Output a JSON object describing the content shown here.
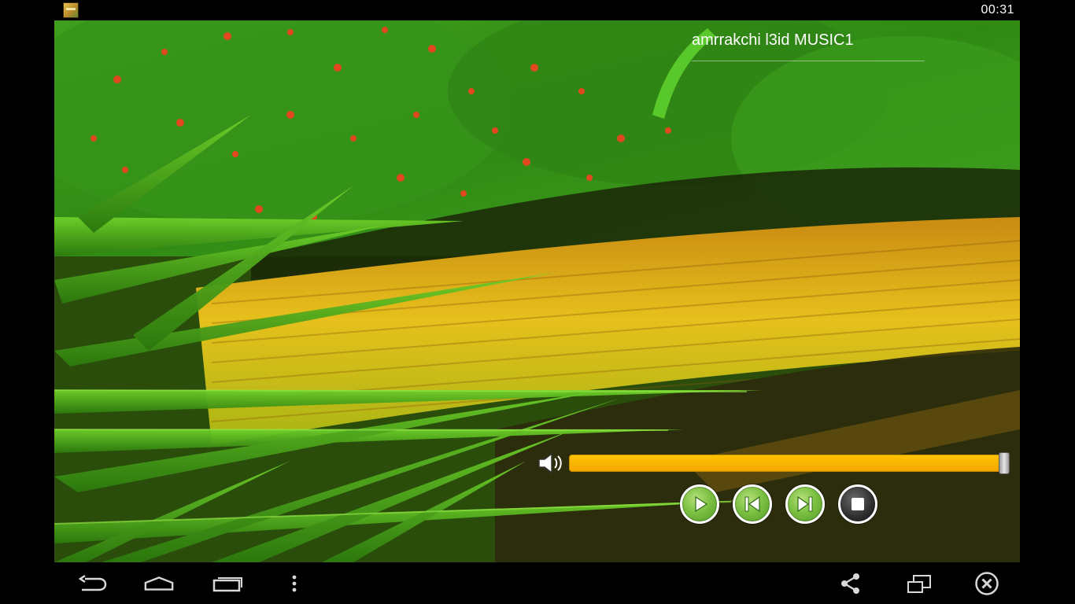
{
  "status_bar": {
    "time": "00:31",
    "notification_icon": "app-icon"
  },
  "player": {
    "track_title": "amrrakchi l3id MUSIC1",
    "volume_level_percent": 100,
    "volume_icon": "speaker-icon",
    "controls": [
      {
        "name": "play-button",
        "icon": "play-icon"
      },
      {
        "name": "previous-button",
        "icon": "skip-previous-icon"
      },
      {
        "name": "next-button",
        "icon": "skip-next-icon"
      },
      {
        "name": "stop-button",
        "icon": "stop-icon"
      }
    ]
  },
  "nav_bar": {
    "left_icons": [
      "back-icon",
      "home-icon",
      "recent-apps-icon",
      "menu-icon"
    ],
    "right_icons": [
      "share-icon",
      "window-icon",
      "close-icon"
    ]
  },
  "colors": {
    "volume_fill": "#ffc400",
    "control_green": "#7dc143",
    "control_dark": "#2d2d2d"
  }
}
